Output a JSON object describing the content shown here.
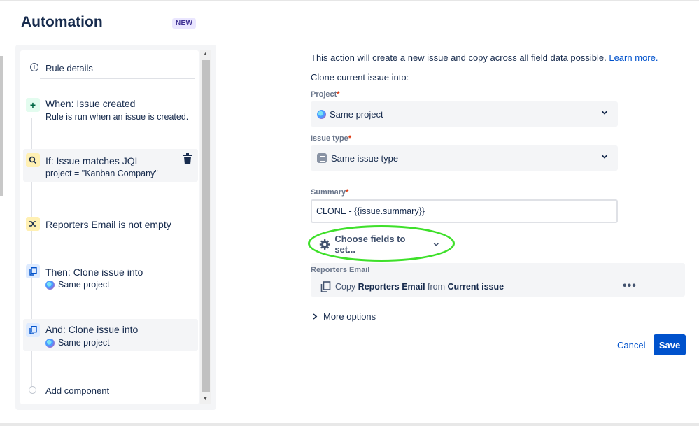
{
  "header": {
    "title": "Automation",
    "badge": "NEW"
  },
  "rule": {
    "details": "Rule details",
    "trigger": {
      "title": "When: Issue created",
      "subtitle": "Rule is run when an issue is created."
    },
    "condition_jql": {
      "title": "If: Issue matches JQL",
      "subtitle": "project = \"Kanban Company\""
    },
    "condition_email": {
      "title": "Reporters Email is not empty"
    },
    "action1": {
      "title": "Then: Clone issue into",
      "subtitle": "Same project"
    },
    "action2": {
      "title": "And: Clone issue into",
      "subtitle": "Same project"
    },
    "add_component": "Add component"
  },
  "config": {
    "description": "This action will create a new issue and copy across all field data possible.",
    "learn_more": "Learn more.",
    "clone_into": "Clone current issue into:",
    "project_label": "Project",
    "project_value": "Same project",
    "issue_type_label": "Issue type",
    "issue_type_value": "Same issue type",
    "summary_label": "Summary",
    "summary_value": "CLONE - {{issue.summary}}",
    "required_mark": "*",
    "choose_fields": "Choose fields to set...",
    "field_label": "Reporters Email",
    "copy_prefix": "Copy",
    "copy_field": "Reporters Email",
    "copy_from": "from",
    "copy_source": "Current issue",
    "more_dots": "•••",
    "more_options": "More options",
    "cancel": "Cancel",
    "save": "Save"
  },
  "colors": {
    "primary": "#0052cc",
    "highlight_ring": "#3ee02a"
  }
}
